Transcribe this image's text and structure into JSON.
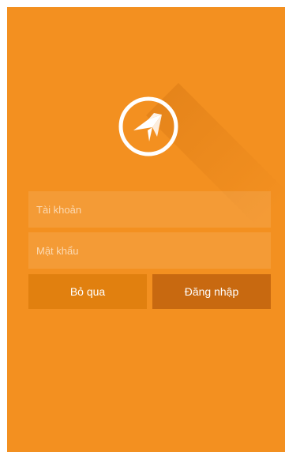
{
  "login_form": {
    "username_placeholder": "Tài khoản",
    "password_placeholder": "Mật khẩu",
    "skip_label": "Bỏ qua",
    "login_label": "Đăng nhập"
  },
  "logo": {
    "icon": "compass-bird-logo"
  },
  "colors": {
    "background": "#f39020",
    "skip_button": "#e1800f",
    "login_button": "#c86910",
    "text": "#ffffff"
  }
}
